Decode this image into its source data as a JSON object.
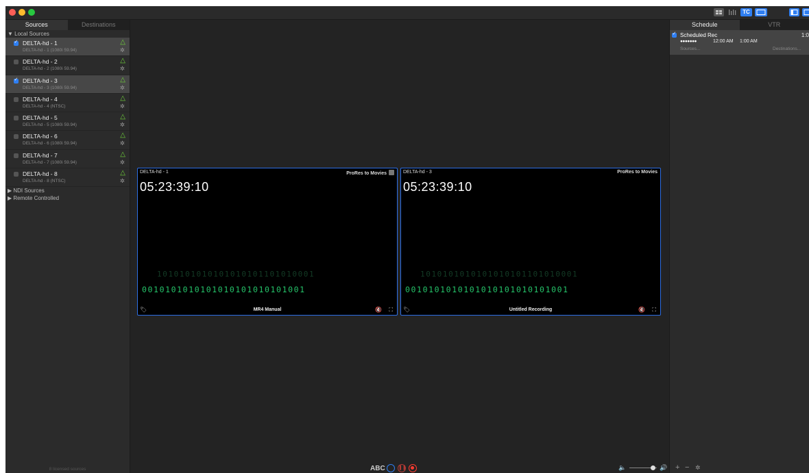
{
  "colors": {
    "accent": "#2f7ff2",
    "monitor_border": "#2d6fe6",
    "warning": "#6fd13a",
    "record": "#ff3b30"
  },
  "titlebar": {
    "icons": [
      "grid-view-icon",
      "audio-meters-icon",
      "timecode-icon",
      "monitor-icon",
      "sidebar-toggle-icon"
    ],
    "tc_label": "TC"
  },
  "sidebar": {
    "tabs": [
      {
        "label": "Sources"
      },
      {
        "label": "Destinations"
      }
    ],
    "local_section": "▼ Local Sources",
    "sources": [
      {
        "name": "DELTA-hd - 1",
        "sub": "DELTA-hd - 1 (1080i 59.94)",
        "checked": true
      },
      {
        "name": "DELTA-hd - 2",
        "sub": "DELTA-hd - 2 (1080i 59.94)",
        "checked": false
      },
      {
        "name": "DELTA-hd - 3",
        "sub": "DELTA-hd - 3 (1080i 59.94)",
        "checked": true
      },
      {
        "name": "DELTA-hd - 4",
        "sub": "DELTA-hd - 4 (NTSC)",
        "checked": false
      },
      {
        "name": "DELTA-hd - 5",
        "sub": "DELTA-hd - 5 (1080i 59.94)",
        "checked": false
      },
      {
        "name": "DELTA-hd - 6",
        "sub": "DELTA-hd - 6 (1080i 59.94)",
        "checked": false
      },
      {
        "name": "DELTA-hd - 7",
        "sub": "DELTA-hd - 7 (1080i 59.94)",
        "checked": false
      },
      {
        "name": "DELTA-hd - 8",
        "sub": "DELTA-hd - 8 (NTSC)",
        "checked": false
      }
    ],
    "ndi_section": "▶ NDI Sources",
    "remote_section": "▶ Remote Controlled",
    "footer": "8 licensed sources"
  },
  "monitors": [
    {
      "name": "DELTA-hd - 1",
      "destination": "ProRes to Movies",
      "timecode": "05:23:39:10",
      "bits_dim": "1010101010101010101101010001",
      "bits_bright": "0010101010101010101010101001",
      "recording_name": "MR4 Manual"
    },
    {
      "name": "DELTA-hd - 3",
      "destination": "ProRes to Movies",
      "timecode": "05:23:39:10",
      "bits_dim": "1010101010101010101101010001",
      "bits_bright": "0010101010101010101010101001",
      "recording_name": "Untitled Recording"
    }
  ],
  "bottom": {
    "abc_label": "ABC",
    "volume_level": 0.85
  },
  "right_panel": {
    "tabs": [
      {
        "label": "Schedule"
      },
      {
        "label": "VTR"
      }
    ],
    "schedule_item": {
      "title": "Scheduled Rec",
      "checked": true,
      "days": "●●●●●●●",
      "start": "12:00 AM",
      "end": "1:00 AM",
      "duration": "1:0",
      "sources_label": "Sources...",
      "destinations_label": "Destinations..."
    },
    "footer_add": "+",
    "footer_remove": "−"
  }
}
